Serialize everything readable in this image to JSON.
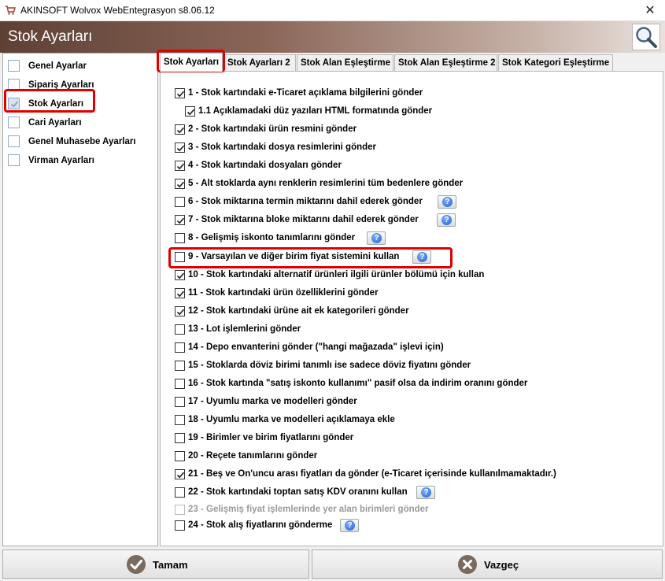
{
  "window": {
    "title": "AKINSOFT Wolvox WebEntegrasyon s8.06.12",
    "close_glyph": "✕"
  },
  "header": {
    "title": "Stok Ayarları",
    "search_icon": "magnifier-icon"
  },
  "sidebar": {
    "items": [
      {
        "label": "Genel Ayarlar",
        "checked": false,
        "selected": false
      },
      {
        "label": "Sipariş Ayarları",
        "checked": false,
        "selected": false
      },
      {
        "label": "Stok Ayarları",
        "checked": true,
        "selected": true
      },
      {
        "label": "Cari Ayarları",
        "checked": false,
        "selected": false
      },
      {
        "label": "Genel Muhasebe Ayarları",
        "checked": false,
        "selected": false
      },
      {
        "label": "Virman Ayarları",
        "checked": false,
        "selected": false
      }
    ]
  },
  "tabs": [
    {
      "label": "Stok Ayarları",
      "active": true
    },
    {
      "label": "Stok Ayarları 2",
      "active": false
    },
    {
      "label": "Stok Alan Eşleştirme",
      "active": false
    },
    {
      "label": "Stok Alan Eşleştirme 2",
      "active": false
    },
    {
      "label": "Stok Kategori Eşleştirme",
      "active": false
    }
  ],
  "options": [
    {
      "label": "1 - Stok kartındaki e-Ticaret açıklama bilgilerini gönder",
      "checked": true,
      "help": false
    },
    {
      "label": "1.1 Açıklamadaki düz yazıları HTML formatında gönder",
      "checked": true,
      "help": false,
      "indent": true
    },
    {
      "label": "2 - Stok kartındaki ürün resmini gönder",
      "checked": true,
      "help": false
    },
    {
      "label": "3 - Stok kartındaki dosya resimlerini gönder",
      "checked": true,
      "help": false
    },
    {
      "label": "4 - Stok kartındaki dosyaları gönder",
      "checked": true,
      "help": false
    },
    {
      "label": "5 - Alt stoklarda aynı renklerin resimlerini tüm bedenlere gönder",
      "checked": true,
      "help": false
    },
    {
      "label": "6 - Stok miktarına termin miktarını dahil ederek gönder",
      "checked": false,
      "help": true
    },
    {
      "label": "7 - Stok miktarına bloke miktarını dahil ederek gönder",
      "checked": true,
      "help": true
    },
    {
      "label": "8 - Gelişmiş iskonto tanımlarını gönder",
      "checked": false,
      "help": true
    },
    {
      "label": "9 - Varsayılan ve diğer birim fiyat sistemini kullan",
      "checked": false,
      "help": true
    },
    {
      "label": "10 - Stok kartındaki alternatif ürünleri ilgili ürünler bölümü için kullan",
      "checked": true,
      "help": false
    },
    {
      "label": "11 - Stok kartındaki ürün özelliklerini gönder",
      "checked": true,
      "help": false
    },
    {
      "label": "12 - Stok kartındaki ürüne ait ek kategorileri gönder",
      "checked": true,
      "help": false
    },
    {
      "label": "13 - Lot işlemlerini gönder",
      "checked": false,
      "help": false
    },
    {
      "label": "14 - Depo envanterini gönder (\"hangi mağazada\" işlevi için)",
      "checked": false,
      "help": false
    },
    {
      "label": "15 - Stoklarda döviz birimi tanımlı ise sadece döviz fiyatını gönder",
      "checked": false,
      "help": false
    },
    {
      "label": "16 - Stok kartında \"satış iskonto kullanımı\" pasif olsa da indirim oranını gönder",
      "checked": false,
      "help": false
    },
    {
      "label": "17 - Uyumlu marka ve modelleri gönder",
      "checked": false,
      "help": false
    },
    {
      "label": "18 - Uyumlu marka ve modelleri açıklamaya ekle",
      "checked": false,
      "help": false
    },
    {
      "label": "19 - Birimler ve birim fiyatlarını gönder",
      "checked": false,
      "help": false
    },
    {
      "label": "20 - Reçete tanımlarını gönder",
      "checked": false,
      "help": false
    },
    {
      "label": "21 - Beş ve On'uncu arası fiyatları da gönder (e-Ticaret içerisinde kullanılmamaktadır.)",
      "checked": true,
      "help": false
    },
    {
      "label": "22 - Stok kartındaki toptan satış KDV oranını kullan",
      "checked": false,
      "help": true
    },
    {
      "label": "23 - Gelişmiş fiyat işlemlerinde yer alan birimleri gönder",
      "checked": false,
      "help": false,
      "disabled": true
    },
    {
      "label": "24 - Stok alış fiyatlarını gönderme",
      "checked": false,
      "help": true
    }
  ],
  "help_glyph": "?",
  "footer": {
    "ok_label": "Tamam",
    "cancel_label": "Vazgeç"
  },
  "colors": {
    "highlight": "#e00000",
    "header_dark": "#5e4035",
    "help_blue": "#1f5fd1"
  }
}
